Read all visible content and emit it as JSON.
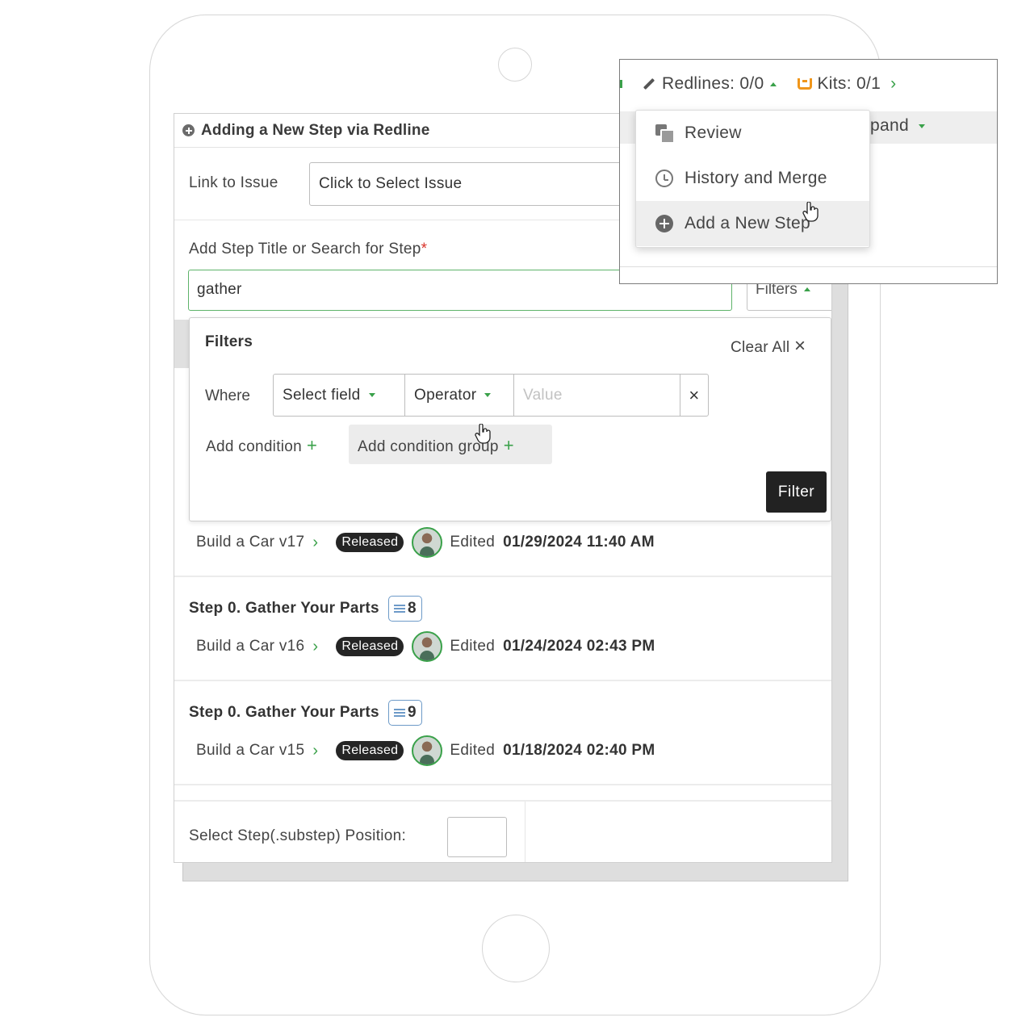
{
  "panel": {
    "title": "Adding a New Step via Redline",
    "link_issue_label": "Link to Issue",
    "issue_placeholder_value": "Click to Select Issue",
    "step_title_label": "Add Step Title or Search for Step",
    "required_mark": "*",
    "search_value": "gather",
    "filters_button": "Filters"
  },
  "filters": {
    "title": "Filters",
    "clear_all": "Clear All",
    "clear_icon": "×",
    "where_label": "Where",
    "field_select": "Select field",
    "operator_select": "Operator",
    "value_placeholder": "Value",
    "remove_icon": "×",
    "add_condition": "Add condition",
    "add_condition_group": "Add condition group",
    "plus": "+",
    "filter_button": "Filter"
  },
  "results": [
    {
      "title": "",
      "count": "",
      "procedure": "Build a Car v17",
      "status": "Released",
      "edited_label": "Edited",
      "edited_date": "01/29/2024 11:40 AM"
    },
    {
      "title": "Step 0. Gather Your Parts",
      "count": "8",
      "procedure": "Build a Car v16",
      "status": "Released",
      "edited_label": "Edited",
      "edited_date": "01/24/2024 02:43 PM"
    },
    {
      "title": "Step 0. Gather Your Parts",
      "count": "9",
      "procedure": "Build a Car v15",
      "status": "Released",
      "edited_label": "Edited",
      "edited_date": "01/18/2024 02:40 PM"
    }
  ],
  "bottom": {
    "position_label": "Select Step(.substep) Position:",
    "position_value": ""
  },
  "inset": {
    "redlines": "Redlines: 0/0",
    "kits": "Kits: 0/1",
    "expand_partial": "pand",
    "menu": [
      {
        "label": "Review",
        "icon": "review-icon"
      },
      {
        "label": "History and Merge",
        "icon": "history-icon"
      },
      {
        "label": "Add a New Step",
        "icon": "add-circle-icon"
      }
    ]
  },
  "colors": {
    "accent_green": "#3aa14a",
    "required_red": "#d9342b",
    "kit_orange": "#f0961b",
    "badge_blue": "#6d9ac8",
    "released_bg": "#252525"
  }
}
